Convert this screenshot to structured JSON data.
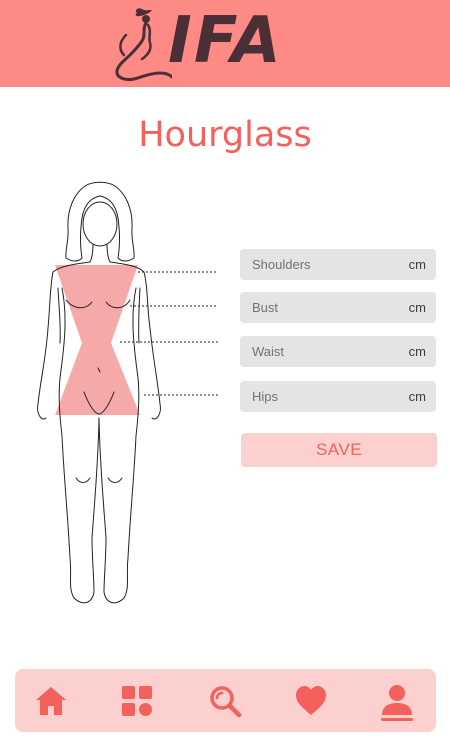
{
  "header": {
    "logo_text": "IFA"
  },
  "page": {
    "title": "Hourglass"
  },
  "fields": [
    {
      "label": "Shoulders",
      "unit": "cm",
      "value": ""
    },
    {
      "label": "Bust",
      "unit": "cm",
      "value": ""
    },
    {
      "label": "Waist",
      "unit": "cm",
      "value": ""
    },
    {
      "label": "Hips",
      "unit": "cm",
      "value": ""
    }
  ],
  "save_label": "SAVE",
  "nav": [
    {
      "icon": "home-icon"
    },
    {
      "icon": "grid-icon"
    },
    {
      "icon": "search-icon"
    },
    {
      "icon": "heart-icon"
    },
    {
      "icon": "profile-icon"
    }
  ],
  "colors": {
    "header_bg": "#fe8a86",
    "accent": "#f4605c",
    "soft_pink": "#fcd0cf",
    "shape_fill": "#f5a9a9",
    "field_bg": "#e4e4e4"
  }
}
